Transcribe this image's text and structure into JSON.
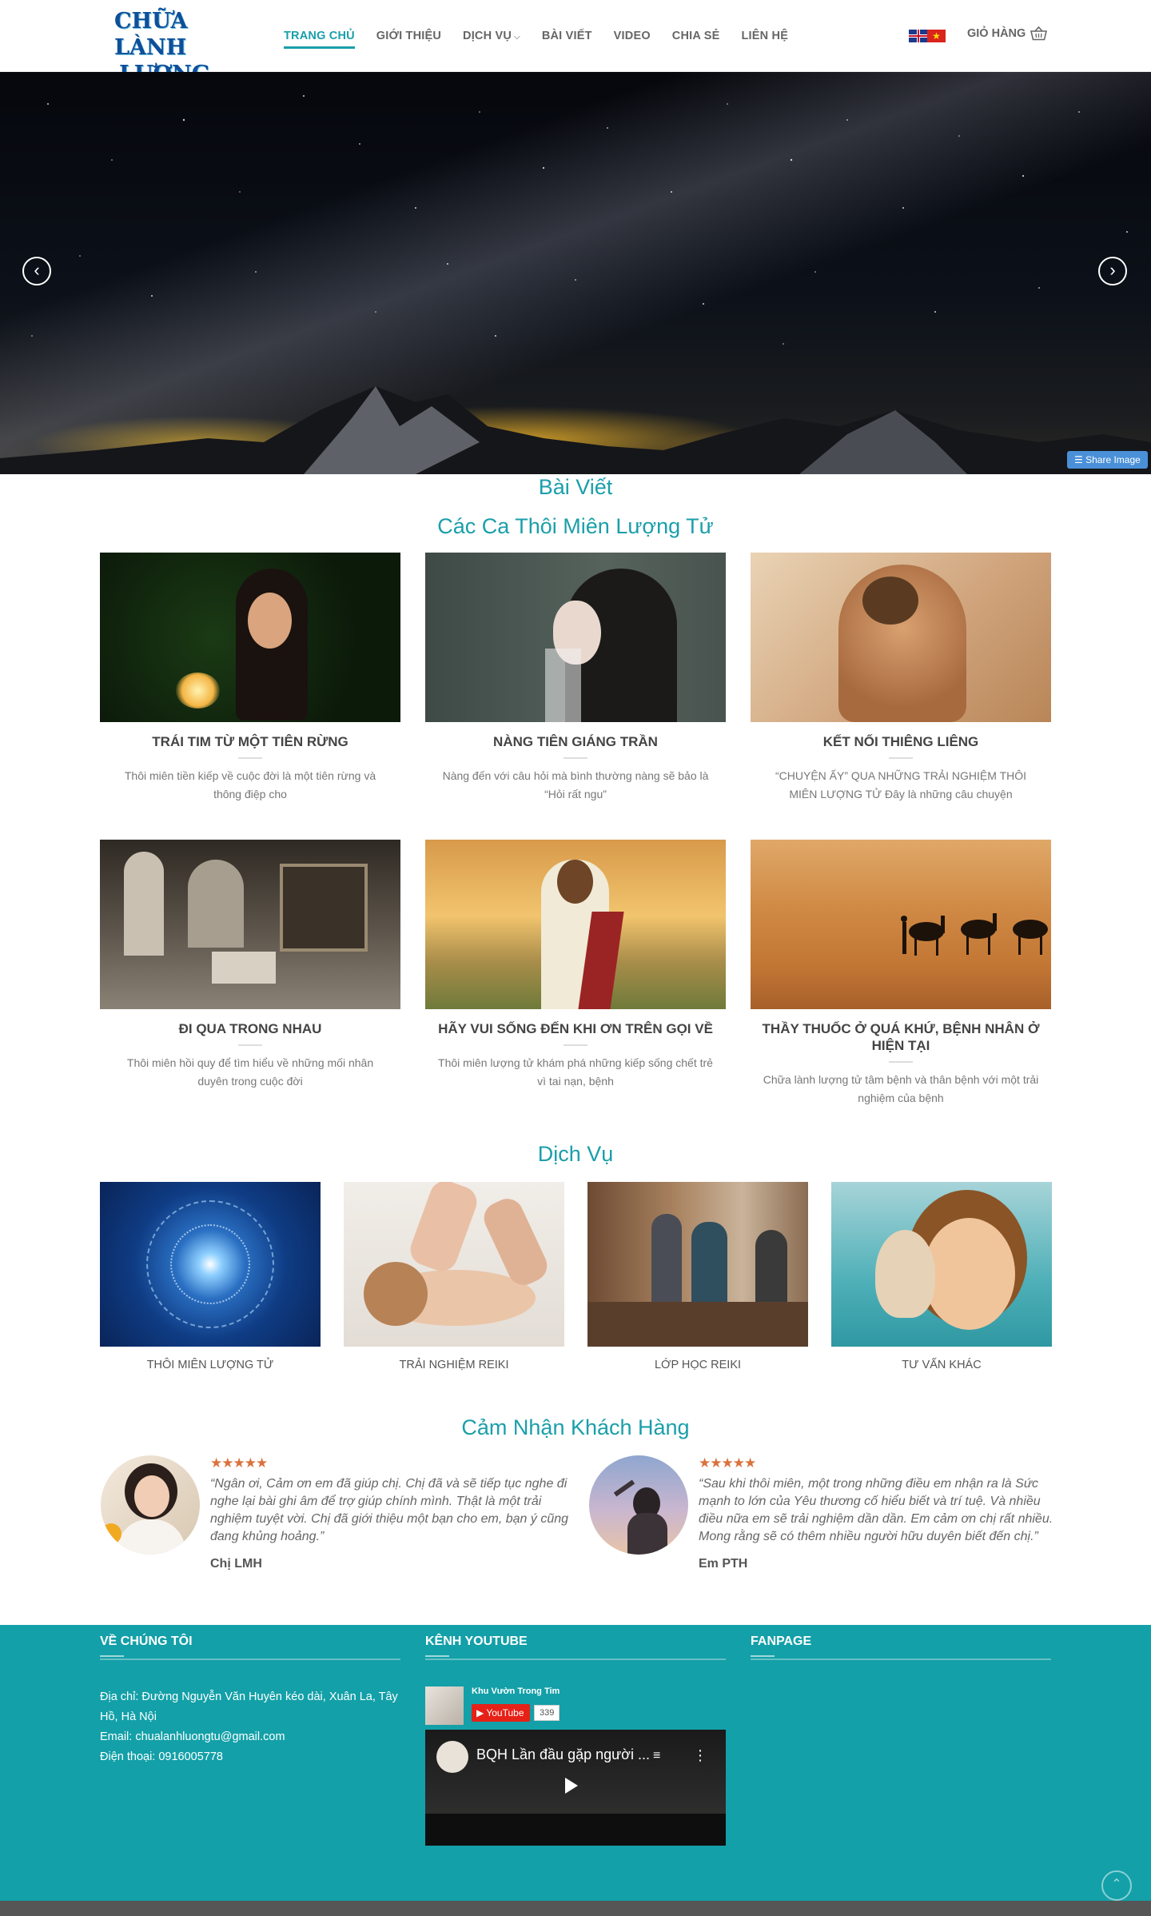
{
  "brand": {
    "line1": "CHỮA LÀNH",
    "line2": "LƯỢNG TỬ"
  },
  "nav": {
    "items": [
      {
        "label": "TRANG CHỦ",
        "active": true
      },
      {
        "label": "GIỚI THIỆU"
      },
      {
        "label": "DỊCH VỤ",
        "has_dropdown": true
      },
      {
        "label": "BÀI VIẾT"
      },
      {
        "label": "VIDEO"
      },
      {
        "label": "CHIA SẺ"
      },
      {
        "label": "LIÊN HỆ"
      }
    ],
    "languages": [
      "en-flag-icon",
      "vn-flag-icon"
    ],
    "cart_label": "GIỎ HÀNG",
    "cart_icon": "basket-icon"
  },
  "slider": {
    "prev_icon": "chevron-left-icon",
    "next_icon": "chevron-right-icon",
    "share_label": "Share Image",
    "share_icon": "layers-icon"
  },
  "posts_section": {
    "heading": "Bài Viết",
    "subheading": "Các Ca Thôi Miên Lượng Tử",
    "posts": [
      {
        "title": "TRÁI TIM TỪ MỘT TIÊN RỪNG",
        "excerpt": "Thôi miên tiền kiếp về cuộc đời là một tiên rừng và thông điệp cho"
      },
      {
        "title": "NÀNG TIÊN GIÁNG TRẦN",
        "excerpt": "Nàng đến với câu hỏi mà bình thường nàng sẽ bảo là “Hỏi rất ngu”"
      },
      {
        "title": "KẾT NỐI THIÊNG LIÊNG",
        "excerpt": "“CHUYỆN ẤY” QUA NHỮNG TRẢI NGHIỆM THÔI MIÊN LƯỢNG TỬ Đây là những câu chuyện"
      },
      {
        "title": "ĐI QUA TRONG NHAU",
        "excerpt": "Thôi miên hồi quy để tìm hiểu về những mối nhân duyên trong cuộc đời"
      },
      {
        "title": "HÃY VUI SỐNG ĐẾN KHI ƠN TRÊN GỌI VỀ",
        "excerpt": "Thôi miên lượng tử khám phá những kiếp sống chết trẻ vì tai nạn, bệnh"
      },
      {
        "title": "THẦY THUỐC Ở QUÁ KHỨ, BỆNH NHÂN Ở HIỆN TẠI",
        "excerpt": "Chữa lành lượng tử tâm bệnh và thân bệnh với một trải nghiệm của bệnh"
      }
    ]
  },
  "services_section": {
    "heading": "Dịch Vụ",
    "items": [
      {
        "label": "THÔI MIÊN LƯỢNG TỬ"
      },
      {
        "label": "TRẢI NGHIỆM REIKI"
      },
      {
        "label": "LỚP HỌC REIKI"
      },
      {
        "label": "TƯ VẤN KHÁC"
      }
    ]
  },
  "testimonials_section": {
    "heading": "Cảm Nhận Khách Hàng",
    "items": [
      {
        "stars": "★★★★★",
        "rating": 5,
        "quote": "“Ngân ơi, Cảm ơn em đã giúp chị. Chị đã và sẽ tiếp tục nghe đi nghe lại bài ghi âm để trợ giúp chính mình. Thật là một trải nghiệm tuyệt vời. Chị đã giới thiệu một bạn cho em, bạn ý cũng đang khủng hoảng.”",
        "name": "Chị LMH"
      },
      {
        "stars": "★★★★★",
        "rating": 5,
        "quote": "“Sau khi thôi miên, một trong những điều em nhận ra là Sức mạnh to lớn của Yêu thương cố hiểu biết và trí tuệ. Và nhiều điều nữa em sẽ trải nghiệm dần dần. Em cảm ơn chị rất nhiều. Mong rằng sẽ có thêm nhiều người hữu duyên biết đến chị.”",
        "name": "Em PTH"
      }
    ]
  },
  "footer": {
    "about": {
      "title": "VỀ CHÚNG TÔI",
      "address": "Địa chỉ: Đường Nguyễn Văn Huyên kéo dài, Xuân La, Tây Hồ, Hà Nội",
      "email": "Email: chualanhluongtu@gmail.com",
      "phone": "Điện thoại: 0916005778"
    },
    "youtube": {
      "title": "KÊNH YOUTUBE",
      "channel": "Khu Vườn Trong Tim",
      "button": "YouTube",
      "subscribers": "339",
      "video_title": "BQH Lần đầu gặp người ..."
    },
    "fanpage": {
      "title": "FANPAGE"
    },
    "back_to_top_icon": "arrow-up-icon"
  },
  "colors": {
    "accent": "#1a9faa",
    "footer_bg": "#13a0a8",
    "stars": "#d9723d",
    "share_button": "#4a90d9"
  }
}
